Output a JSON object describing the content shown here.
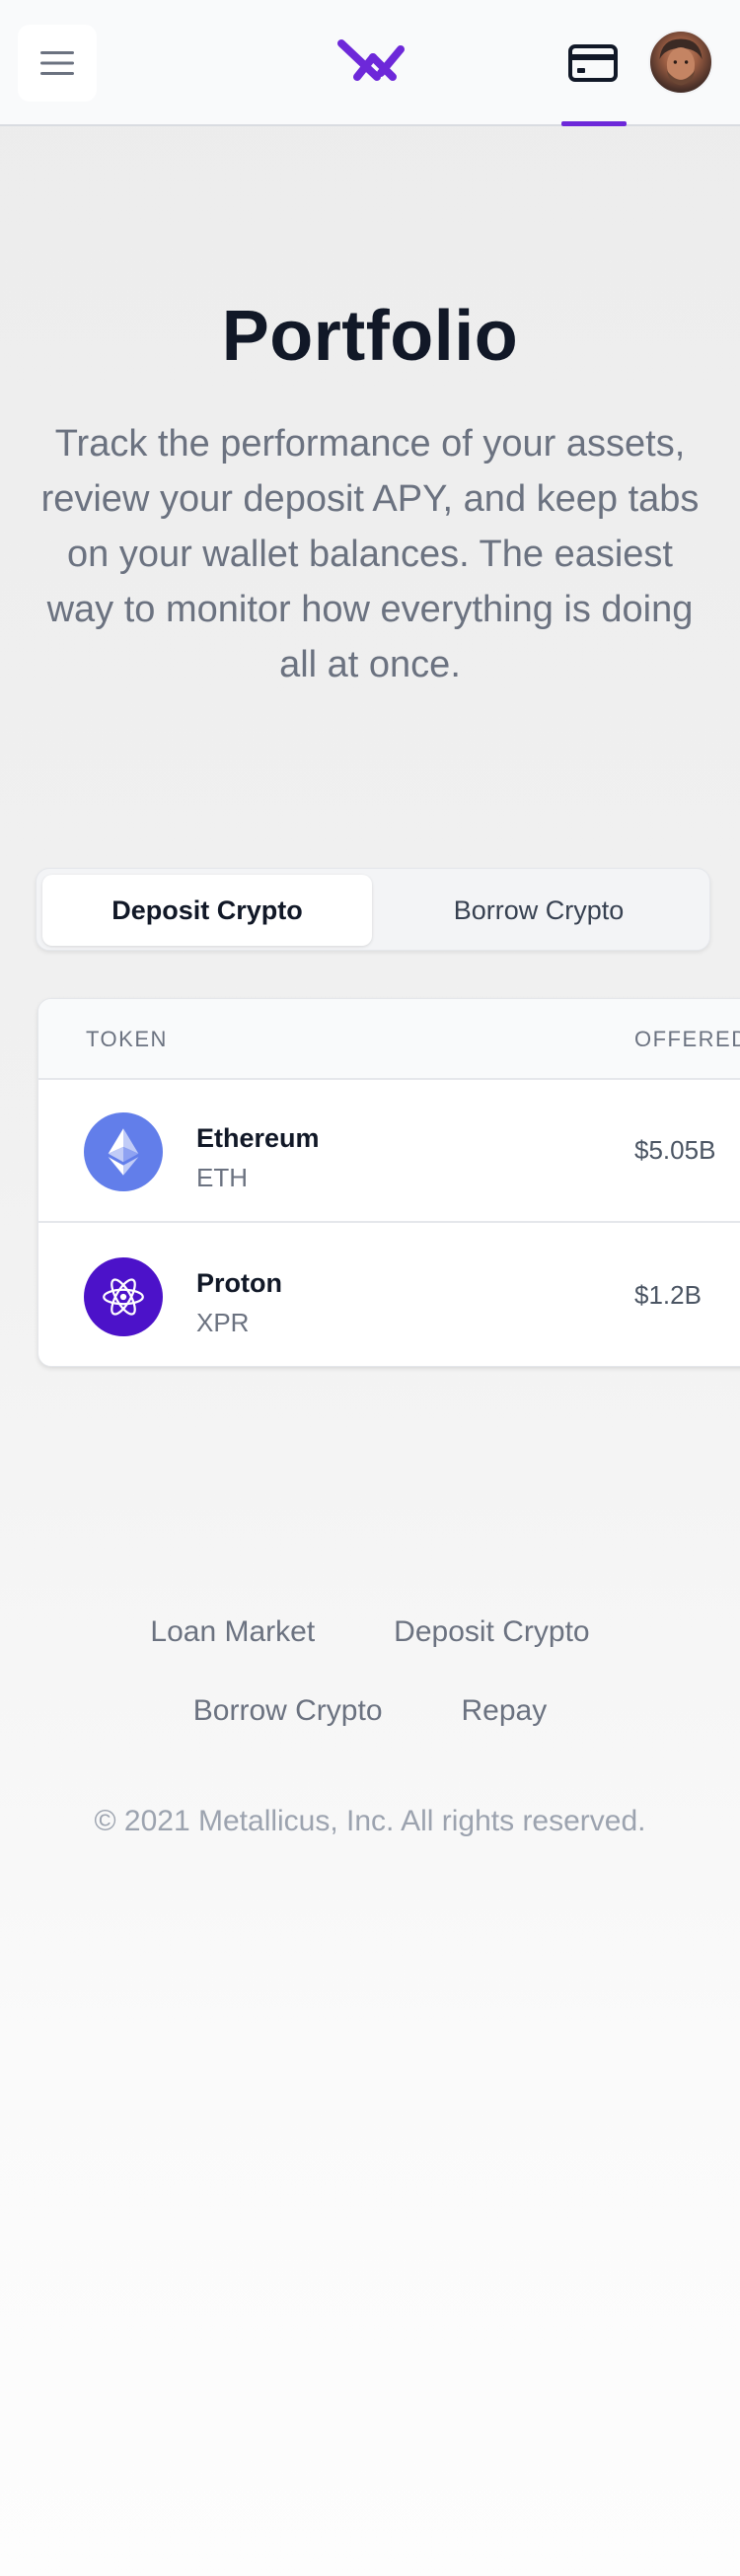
{
  "header": {
    "menu_icon": "hamburger-icon",
    "logo_icon": "metallicus-logo",
    "wallet_icon": "credit-card-icon",
    "avatar": "user-avatar",
    "accent_color": "#6d28d9"
  },
  "hero": {
    "title": "Portfolio",
    "subtitle": "Track the performance of your assets, review your deposit APY, and keep tabs on your wallet balances. The easiest way to monitor how everything is doing all at once."
  },
  "tabs": [
    {
      "label": "Deposit Crypto",
      "active": true
    },
    {
      "label": "Borrow Crypto",
      "active": false
    }
  ],
  "table": {
    "columns": [
      "TOKEN",
      "OFFERED"
    ],
    "rows": [
      {
        "name": "Ethereum",
        "symbol": "ETH",
        "offered": "$5.05B",
        "icon": "ethereum-icon",
        "color": "#627eea"
      },
      {
        "name": "Proton",
        "symbol": "XPR",
        "offered": "$1.2B",
        "icon": "proton-icon",
        "color": "#4c12c9"
      }
    ]
  },
  "footer": {
    "links": [
      "Loan Market",
      "Deposit Crypto",
      "Borrow Crypto",
      "Repay"
    ],
    "copyright": "© 2021 Metallicus, Inc. All rights reserved."
  }
}
